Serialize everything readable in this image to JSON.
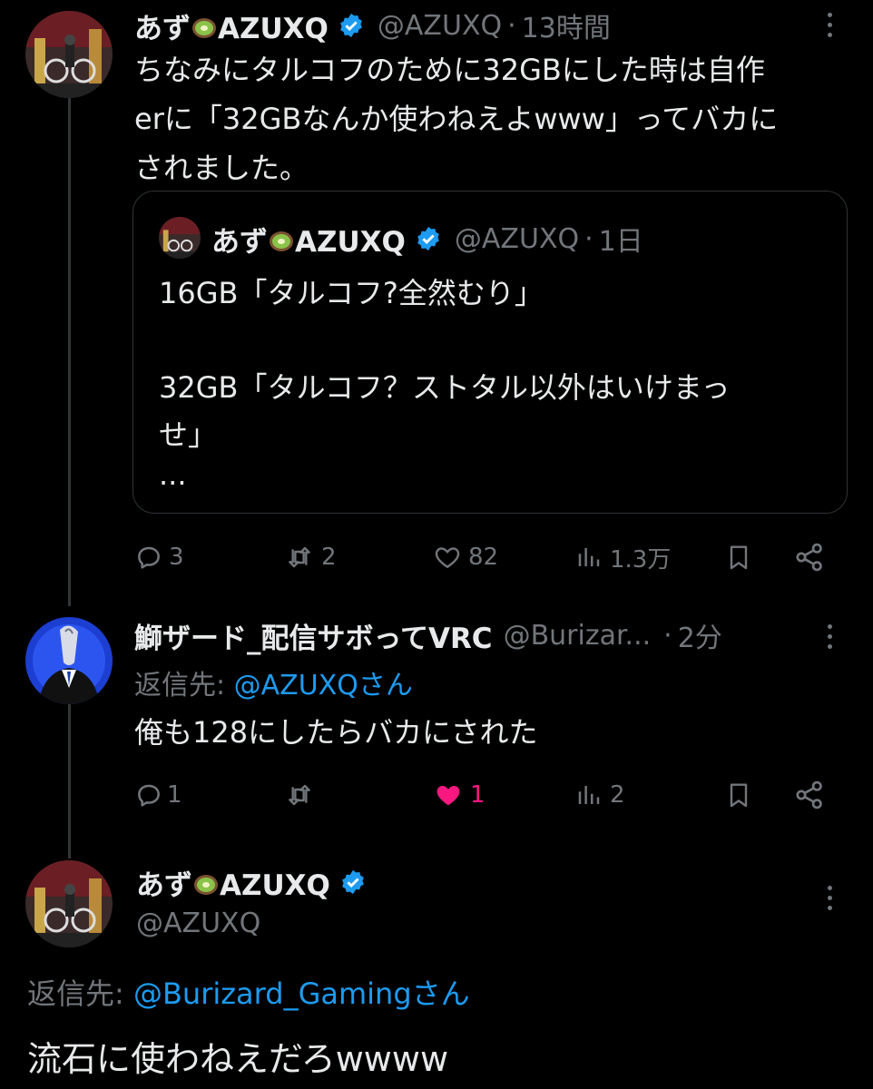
{
  "tweet1": {
    "display_name": "あず",
    "display_name_suffix": "AZUXQ",
    "name_emoji": "kiwi-emoji",
    "verified": true,
    "handle": "@AZUXQ",
    "time": "13時間",
    "text_lines": [
      "ちなみにタルコフのために32GBにした時は自作",
      "erに「32GBなんか使わねえよwww」ってバカに",
      "されました。"
    ],
    "quote": {
      "display_name": "あず",
      "display_name_suffix": "AZUXQ",
      "handle": "@AZUXQ",
      "time": "1日",
      "text_lines": [
        "16GB「タルコフ?全然むり」",
        "",
        "32GB「タルコフ？ストタル以外はいけまっ",
        "せ」",
        "..."
      ]
    },
    "stats": {
      "replies": "3",
      "retweets": "2",
      "likes": "82",
      "views": "1.3万"
    }
  },
  "tweet2": {
    "display_name": "鰤ザード_配信サボってVRC",
    "handle": "@Burizar...",
    "time": "2分",
    "reply_to_label": "返信先: ",
    "reply_to_user": "@AZUXQさん",
    "text": "俺も128にしたらバカにされた",
    "stats": {
      "replies": "1",
      "retweets": "",
      "likes": "1",
      "views": "2"
    },
    "liked": true
  },
  "tweet3": {
    "display_name": "あず",
    "display_name_suffix": "AZUXQ",
    "handle": "@AZUXQ",
    "reply_to_label": "返信先: ",
    "reply_to_user": "@Burizard_Gamingさん",
    "text": "流石に使わねえだろwwww"
  },
  "colors": {
    "background": "#000000",
    "text": "#e7e9ea",
    "secondary": "#71767b",
    "link": "#1d9bf0",
    "like": "#f91880",
    "verified": "#1d9bf0"
  }
}
